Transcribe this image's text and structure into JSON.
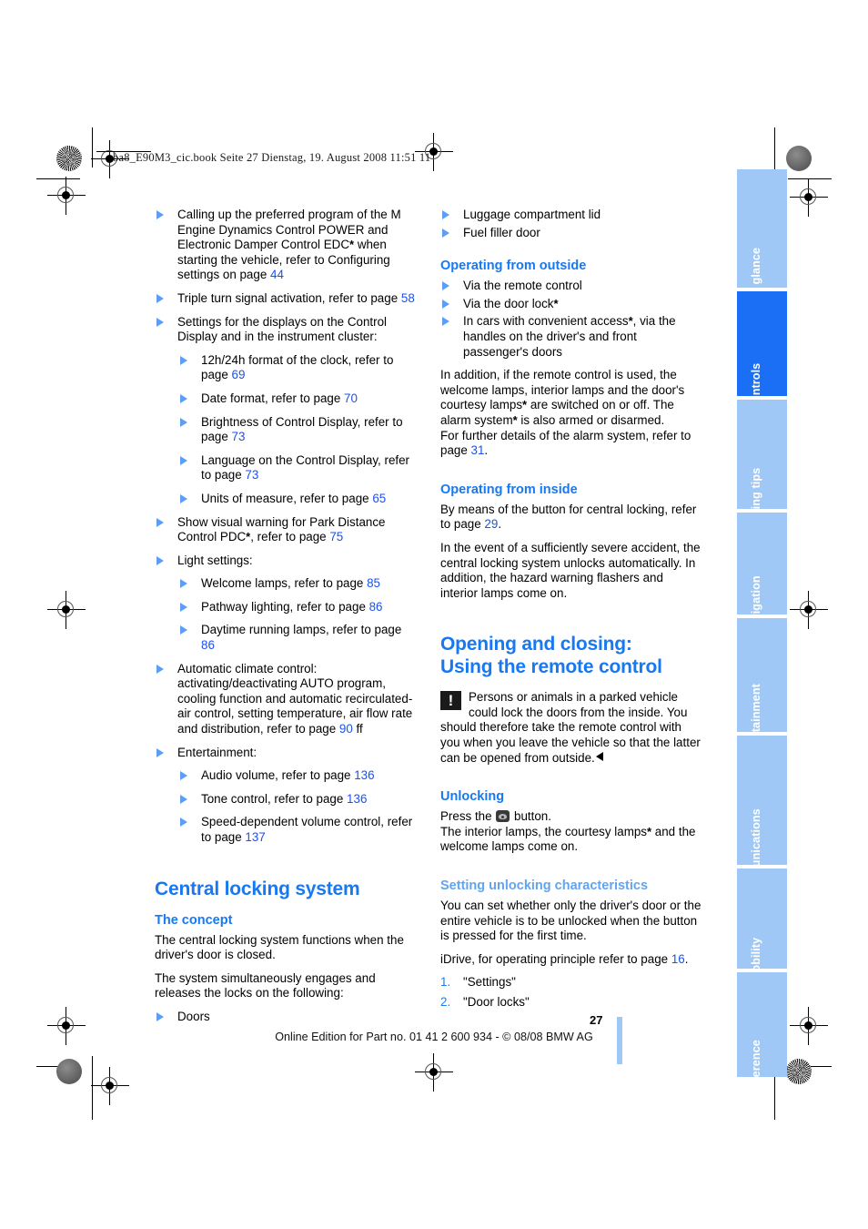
{
  "document": {
    "header_line": "ba8_E90M3_cic.book  Seite 27  Dienstag, 19. August 2008  11:51 11",
    "page_number": "27",
    "footer": "Online Edition for Part no. 01 41 2 600 934 - © 08/08 BMW AG"
  },
  "colors": {
    "heading_blue": "#1878f0",
    "subheading_light_blue": "#62a4ef",
    "reference_blue": "#1a52f0",
    "bullet_blue": "#5c9ef5",
    "tab_inactive": "#9fc8f7",
    "tab_active": "#1a6ff5"
  },
  "left_column": {
    "bullets": [
      {
        "level": 1,
        "text_parts": [
          {
            "t": "Calling up the preferred program of the M Engine Dynamics Control POWER and Electronic Damper Control EDC"
          },
          {
            "t": "*",
            "style": "star"
          },
          {
            "t": " when starting the vehicle, refer to Configuring settings on page "
          },
          {
            "t": "44",
            "style": "ref"
          }
        ]
      },
      {
        "level": 1,
        "text_parts": [
          {
            "t": "Triple turn signal activation, refer to page "
          },
          {
            "t": "58",
            "style": "ref"
          }
        ]
      },
      {
        "level": 1,
        "text_parts": [
          {
            "t": "Settings for the displays on the Control Display and in the instrument cluster:"
          }
        ]
      },
      {
        "level": 2,
        "text_parts": [
          {
            "t": "12h/24h format of the clock, refer to page "
          },
          {
            "t": "69",
            "style": "ref"
          }
        ]
      },
      {
        "level": 2,
        "text_parts": [
          {
            "t": "Date format, refer to page "
          },
          {
            "t": "70",
            "style": "ref"
          }
        ]
      },
      {
        "level": 2,
        "text_parts": [
          {
            "t": "Brightness of Control Display, refer to page "
          },
          {
            "t": "73",
            "style": "ref"
          }
        ]
      },
      {
        "level": 2,
        "text_parts": [
          {
            "t": "Language on the Control Display, refer to page "
          },
          {
            "t": "73",
            "style": "ref"
          }
        ]
      },
      {
        "level": 2,
        "text_parts": [
          {
            "t": "Units of measure, refer to page "
          },
          {
            "t": "65",
            "style": "ref"
          }
        ]
      },
      {
        "level": 1,
        "text_parts": [
          {
            "t": "Show visual warning for Park Distance Control PDC"
          },
          {
            "t": "*",
            "style": "star"
          },
          {
            "t": ", refer to page "
          },
          {
            "t": "75",
            "style": "ref"
          }
        ]
      },
      {
        "level": 1,
        "text_parts": [
          {
            "t": "Light settings:"
          }
        ]
      },
      {
        "level": 2,
        "text_parts": [
          {
            "t": "Welcome lamps, refer to page "
          },
          {
            "t": "85",
            "style": "ref"
          }
        ]
      },
      {
        "level": 2,
        "text_parts": [
          {
            "t": "Pathway lighting, refer to page "
          },
          {
            "t": "86",
            "style": "ref"
          }
        ]
      },
      {
        "level": 2,
        "text_parts": [
          {
            "t": "Daytime running lamps, refer to page "
          },
          {
            "t": "86",
            "style": "ref"
          }
        ]
      },
      {
        "level": 1,
        "text_parts": [
          {
            "t": "Automatic climate control: activating/deactivating AUTO program, cooling function and automatic recirculated-air control, setting temperature, air flow rate and distribution, refer to page "
          },
          {
            "t": "90",
            "style": "ref"
          },
          {
            "t": " ff"
          }
        ]
      },
      {
        "level": 1,
        "text_parts": [
          {
            "t": "Entertainment:"
          }
        ]
      },
      {
        "level": 2,
        "text_parts": [
          {
            "t": "Audio volume, refer to page "
          },
          {
            "t": "136",
            "style": "ref"
          }
        ]
      },
      {
        "level": 2,
        "text_parts": [
          {
            "t": "Tone control, refer to page "
          },
          {
            "t": "136",
            "style": "ref"
          }
        ]
      },
      {
        "level": 2,
        "text_parts": [
          {
            "t": "Speed-dependent volume control, refer to page "
          },
          {
            "t": "137",
            "style": "ref"
          }
        ]
      }
    ],
    "section_title": "Central locking system",
    "concept_heading": "The concept",
    "concept_p1": "The central locking system functions when the driver's door is closed.",
    "concept_p2": "The system simultaneously engages and releases the locks on the following:",
    "concept_bullet": "Doors"
  },
  "right_column": {
    "top_bullets": [
      "Luggage compartment lid",
      "Fuel filler door"
    ],
    "operating_outside_heading": "Operating from outside",
    "outside_bullets": [
      {
        "text_parts": [
          {
            "t": "Via the remote control"
          }
        ]
      },
      {
        "text_parts": [
          {
            "t": "Via the door lock"
          },
          {
            "t": "*",
            "style": "star"
          }
        ]
      },
      {
        "text_parts": [
          {
            "t": "In cars with convenient access"
          },
          {
            "t": "*",
            "style": "star"
          },
          {
            "t": ", via the handles on the driver's and front passenger's doors"
          }
        ]
      }
    ],
    "outside_paragraph_parts": [
      {
        "t": "In addition, if the remote control is used, the welcome lamps, interior lamps and the door's courtesy lamps"
      },
      {
        "t": "*",
        "style": "star"
      },
      {
        "t": " are switched on or off. The alarm system"
      },
      {
        "t": "*",
        "style": "star"
      },
      {
        "t": " is also armed or disarmed."
      }
    ],
    "outside_paragraph2_parts": [
      {
        "t": "For further details of the alarm system, refer to page "
      },
      {
        "t": "31",
        "style": "ref"
      },
      {
        "t": "."
      }
    ],
    "operating_inside_heading": "Operating from inside",
    "inside_p1_parts": [
      {
        "t": "By means of the button for central locking, refer to page "
      },
      {
        "t": "29",
        "style": "ref"
      },
      {
        "t": "."
      }
    ],
    "inside_p2": "In the event of a sufficiently severe accident, the central locking system unlocks automatically. In addition, the hazard warning flashers and interior lamps come on.",
    "remote_title_line1": "Opening and closing:",
    "remote_title_line2": "Using the remote control",
    "warning_text": "Persons or animals in a parked vehicle could lock the doors from the inside. You should therefore take the remote control with you when you leave the vehicle so that the latter can be opened from outside.",
    "warning_icon_glyph": "!",
    "unlocking_heading": "Unlocking",
    "unlocking_p1_pre": "Press the ",
    "unlocking_p1_post": " button.",
    "unlocking_p2_parts": [
      {
        "t": "The interior lamps, the courtesy lamps"
      },
      {
        "t": "*",
        "style": "star"
      },
      {
        "t": " and the welcome lamps come on."
      }
    ],
    "setting_unlocking_heading": "Setting unlocking characteristics",
    "setting_p1": "You can set whether only the driver's door or the entire vehicle is to be unlocked when the button is pressed for the first time.",
    "setting_p2_parts": [
      {
        "t": "iDrive, for operating principle refer to page "
      },
      {
        "t": "16",
        "style": "ref"
      },
      {
        "t": "."
      }
    ],
    "steps": [
      {
        "num": "1.",
        "label": "\"Settings\""
      },
      {
        "num": "2.",
        "label": "\"Door locks\""
      }
    ]
  },
  "sidebar": {
    "tabs": [
      {
        "label": "At a glance",
        "active": false
      },
      {
        "label": "Controls",
        "active": true
      },
      {
        "label": "Driving tips",
        "active": false
      },
      {
        "label": "Navigation",
        "active": false
      },
      {
        "label": "Entertainment",
        "active": false
      },
      {
        "label": "Communications",
        "active": false
      },
      {
        "label": "Mobility",
        "active": false
      },
      {
        "label": "Reference",
        "active": false
      }
    ]
  }
}
